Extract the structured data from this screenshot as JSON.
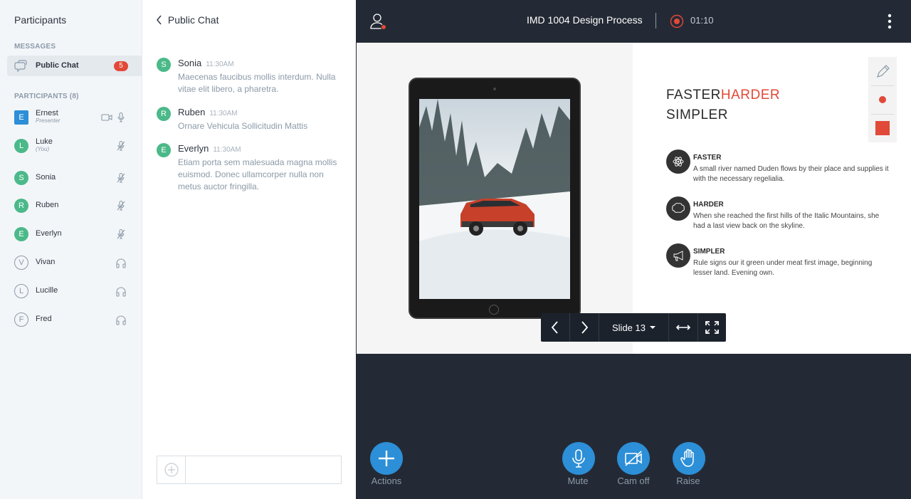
{
  "sidebar": {
    "title": "Participants",
    "messages_label": "MESSAGES",
    "public_chat": {
      "label": "Public Chat",
      "unread": "5"
    },
    "participants_label": "PARTICIPANTS (8)",
    "participants": [
      {
        "initial": "E",
        "name": "Ernest",
        "sub": "Presenter",
        "color": "#2c8fd7",
        "style": "square",
        "icons": [
          "camera-icon",
          "microphone-icon"
        ]
      },
      {
        "initial": "L",
        "name": "Luke",
        "sub": "(You)",
        "color": "#4bb989",
        "style": "circle",
        "icons": [
          "microphone-muted-icon"
        ]
      },
      {
        "initial": "S",
        "name": "Sonia",
        "sub": "",
        "color": "#4bb989",
        "style": "circle",
        "icons": [
          "microphone-muted-icon"
        ]
      },
      {
        "initial": "R",
        "name": "Ruben",
        "sub": "",
        "color": "#4bb989",
        "style": "circle",
        "icons": [
          "microphone-muted-icon"
        ]
      },
      {
        "initial": "E",
        "name": "Everlyn",
        "sub": "",
        "color": "#4bb989",
        "style": "circle",
        "icons": [
          "microphone-muted-icon"
        ]
      },
      {
        "initial": "V",
        "name": "Vivan",
        "sub": "",
        "color": "#8b9aa8",
        "style": "outline",
        "icons": [
          "headphones-icon"
        ]
      },
      {
        "initial": "L",
        "name": "Lucille",
        "sub": "",
        "color": "#8b9aa8",
        "style": "outline",
        "icons": [
          "headphones-icon"
        ]
      },
      {
        "initial": "F",
        "name": "Fred",
        "sub": "",
        "color": "#8b9aa8",
        "style": "outline",
        "icons": [
          "headphones-icon"
        ]
      }
    ]
  },
  "chat": {
    "title": "Public Chat",
    "messages": [
      {
        "initial": "S",
        "name": "Sonia",
        "time": "11:30AM",
        "text": "Maecenas faucibus mollis interdum. Nulla vitae elit libero, a pharetra."
      },
      {
        "initial": "R",
        "name": "Ruben",
        "time": "11:30AM",
        "text": "Ornare Vehicula Sollicitudin Mattis"
      },
      {
        "initial": "E",
        "name": "Everlyn",
        "time": "11:30AM",
        "text": "Etiam porta sem malesuada magna mollis euismod. Donec ullamcorper nulla non metus auctor fringilla."
      }
    ],
    "input_value": ""
  },
  "topbar": {
    "meeting_title": "IMD 1004 Design Process",
    "recording_time": "01:10"
  },
  "slide": {
    "heading_a": "FASTER",
    "heading_b": "HARDER",
    "heading_c": "SIMPLER",
    "features": [
      {
        "icon": "atom-icon",
        "title": "FASTER",
        "text": "A small river named Duden flows by their place and supplies it with the necessary regelialia."
      },
      {
        "icon": "brain-icon",
        "title": "HARDER",
        "text": "When she reached the first hills of the Italic Mountains, she had a last view back on the skyline."
      },
      {
        "icon": "megaphone-icon",
        "title": "SIMPLER",
        "text": "Rule signs our it green under meat first image, beginning lesser land. Evening own."
      }
    ],
    "controls": {
      "slide_label": "Slide 13"
    },
    "tool_colors": {
      "accent": "#e14938"
    }
  },
  "actions": {
    "actions_label": "Actions",
    "mute_label": "Mute",
    "cam_label": "Cam off",
    "raise_label": "Raise"
  },
  "colors": {
    "brand_blue": "#2c8fd7",
    "green": "#4bb989",
    "dark": "#242a35",
    "red": "#e14938"
  }
}
